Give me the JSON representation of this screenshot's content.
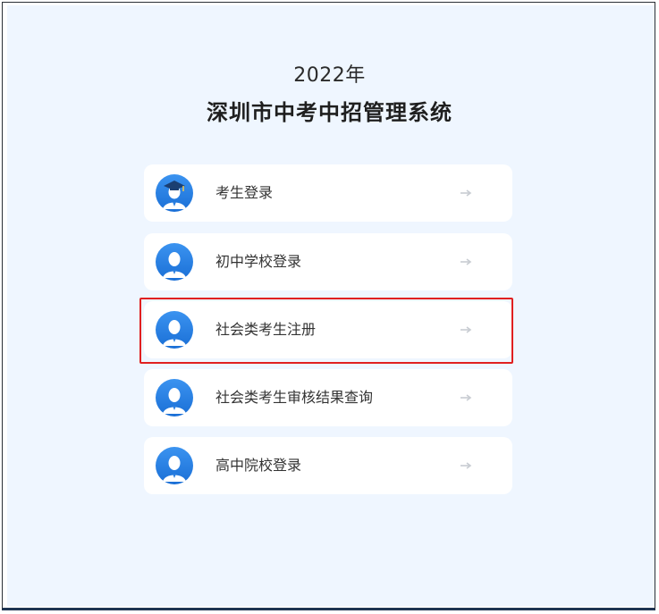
{
  "header": {
    "year": "2022年",
    "system_title": "深圳市中考中招管理系统"
  },
  "menu": {
    "items": [
      {
        "label": "考生登录",
        "icon": "graduate-avatar-icon"
      },
      {
        "label": "初中学校登录",
        "icon": "person-avatar-icon"
      },
      {
        "label": "社会类考生注册",
        "icon": "person-avatar-icon",
        "highlighted": true
      },
      {
        "label": "社会类考生审核结果查询",
        "icon": "person-avatar-icon"
      },
      {
        "label": "高中院校登录",
        "icon": "person-avatar-icon"
      }
    ]
  },
  "colors": {
    "background": "#eff6ff",
    "card": "#ffffff",
    "avatar_blue": "#2b7fe0",
    "highlight_red": "#e02020",
    "arrow_gray": "#c8ccd2"
  }
}
